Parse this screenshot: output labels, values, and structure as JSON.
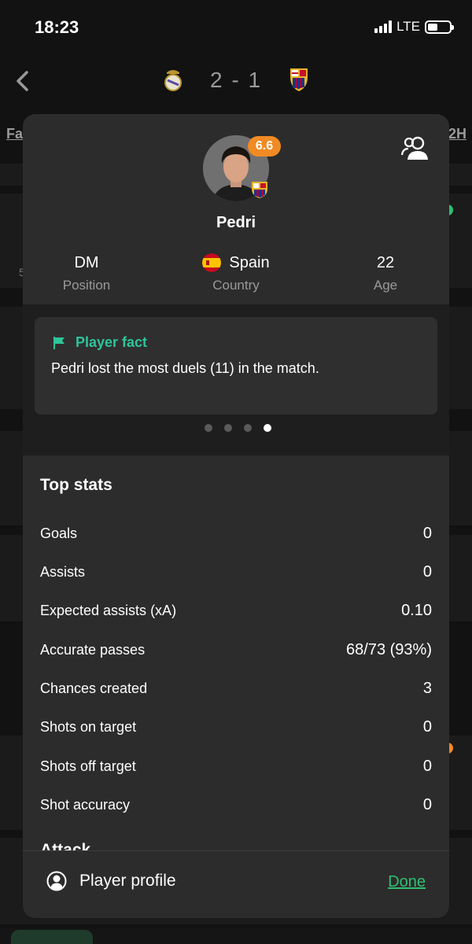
{
  "status_bar": {
    "time": "18:23",
    "network": "LTE"
  },
  "match": {
    "score": "2 - 1",
    "home_crest": "real-madrid-crest",
    "away_crest": "barcelona-crest",
    "tab_left": "Fa",
    "tab_right": "2H",
    "bg_row_number": "5"
  },
  "player": {
    "name": "Pedri",
    "rating": "6.6",
    "position_value": "DM",
    "position_label": "Position",
    "country_value": "Spain",
    "country_label": "Country",
    "age_value": "22",
    "age_label": "Age"
  },
  "fact": {
    "title": "Player fact",
    "text": "Pedri lost the most duels (11) in the match.",
    "pages": 4,
    "active_page": 4
  },
  "stats": {
    "title": "Top stats",
    "rows": [
      {
        "label": "Goals",
        "value": "0"
      },
      {
        "label": "Assists",
        "value": "0"
      },
      {
        "label": "Expected assists (xA)",
        "value": "0.10"
      },
      {
        "label": "Accurate passes",
        "value": "68/73 (93%)"
      },
      {
        "label": "Chances created",
        "value": "3"
      },
      {
        "label": "Shots on target",
        "value": "0"
      },
      {
        "label": "Shots off target",
        "value": "0"
      },
      {
        "label": "Shot accuracy",
        "value": "0"
      }
    ],
    "next_section": "Attack"
  },
  "footer": {
    "profile_label": "Player profile",
    "done_label": "Done"
  },
  "colors": {
    "accent_green": "#2fbf71",
    "fact_green": "#2ec59a",
    "rating_orange": "#f08a24",
    "sheet_bg": "#2c2c2c"
  }
}
